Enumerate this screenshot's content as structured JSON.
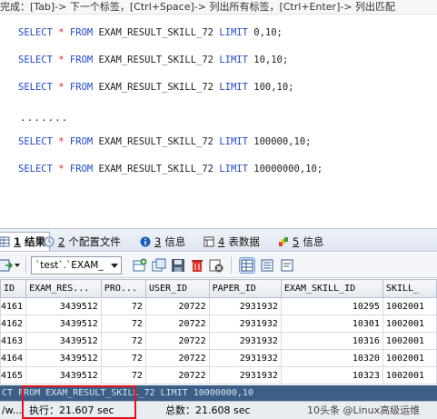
{
  "hint_bar": {
    "text": "完成：[Tab]-> 下一个标签，[Ctrl+Space]-> 列出所有标签，[Ctrl+Enter]-> 列出匹配"
  },
  "editor": {
    "lines": [
      {
        "kw1": "SELECT",
        "op": "*",
        "kw2": "FROM",
        "table": "EXAM_RESULT_SKILL_72",
        "kw3": "LIMIT",
        "args": "0,10;"
      },
      {
        "kw1": "SELECT",
        "op": "*",
        "kw2": "FROM",
        "table": "EXAM_RESULT_SKILL_72",
        "kw3": "LIMIT",
        "args": "10,10;"
      },
      {
        "kw1": "SELECT",
        "op": "*",
        "kw2": "FROM",
        "table": "EXAM_RESULT_SKILL_72",
        "kw3": "LIMIT",
        "args": "100,10;"
      },
      {
        "kw1": "SELECT",
        "op": "*",
        "kw2": "FROM",
        "table": "EXAM_RESULT_SKILL_72",
        "kw3": "LIMIT",
        "args": "100000,10;"
      },
      {
        "kw1": "SELECT",
        "op": "*",
        "kw2": "FROM",
        "table": "EXAM_RESULT_SKILL_72",
        "kw3": "LIMIT",
        "args": "10000000,10;"
      }
    ],
    "ellipsis": "......."
  },
  "tabs": [
    {
      "num": "1",
      "label": "结果"
    },
    {
      "num": "2",
      "label": "个配置文件"
    },
    {
      "num": "3",
      "label": "信息"
    },
    {
      "num": "4",
      "label": "表数据"
    },
    {
      "num": "5",
      "label": "信息"
    }
  ],
  "toolbar": {
    "table_select": "`test`.`EXAM_"
  },
  "grid": {
    "columns": [
      "ID",
      "EXAM_RES...",
      "PRO...",
      "USER_ID",
      "PAPER_ID",
      "EXAM_SKILL_ID",
      "SKILL_"
    ],
    "rows": [
      [
        "4161",
        "3439512",
        "72",
        "20722",
        "2931932",
        "10295",
        "1002001"
      ],
      [
        "4162",
        "3439512",
        "72",
        "20722",
        "2931932",
        "10301",
        "1002001"
      ],
      [
        "4163",
        "3439512",
        "72",
        "20722",
        "2931932",
        "10316",
        "1002001"
      ],
      [
        "4164",
        "3439512",
        "72",
        "20722",
        "2931932",
        "10320",
        "1002001"
      ],
      [
        "4165",
        "3439512",
        "72",
        "20722",
        "2931932",
        "10323",
        "1002001"
      ]
    ]
  },
  "sql_bar": {
    "text": "CT  FROM EXAM_RESULT_SKILL_72 LIMIT 10000000,10"
  },
  "status": {
    "left": "/w...",
    "exec": "执行：21.607 sec",
    "total": "总数：21.608 sec",
    "right": "10头条 @Linux高级运维"
  },
  "colors": {
    "keyword": "#1f48c8",
    "operator": "#e0202a",
    "highlight_box": "#e0141b",
    "sql_bar": "#3d5e86"
  }
}
